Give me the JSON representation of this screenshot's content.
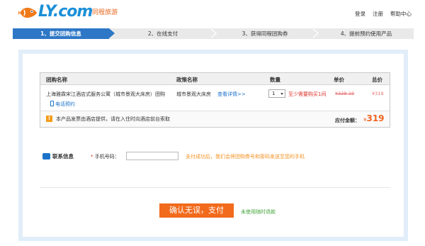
{
  "brand": {
    "logo_text": "LY.com",
    "logo_sub": "同程旅游"
  },
  "top_links": [
    "登录",
    "注册",
    "帮助中心"
  ],
  "steps": [
    "1、提交团购信息",
    "2、在线支付",
    "3、获得同程团购券",
    "4、提前预约使用产品"
  ],
  "table": {
    "headers": {
      "name": "团购名称",
      "policy": "政策名称",
      "qty": "数量",
      "unit": "单价",
      "total": "总价"
    },
    "row": {
      "hotel": "上海雅霖宋江酒店式服务公寓（城市景观大床房）团购",
      "phone_link": "电话预约",
      "policy": "城市景观大床房",
      "detail": "查看详情>>",
      "qty": "1",
      "min_buy": "至少需要购买1间",
      "orig_price": "¥338-19",
      "price": "¥319"
    },
    "footer": {
      "note": "本产品发票由酒店提供，请在入住时向酒店前台索取",
      "total_label": "应付金额：",
      "total_currency": "¥",
      "total_value": "319"
    }
  },
  "contact": {
    "title": "联系信息",
    "star": "*",
    "phone_label": "手机号码：",
    "phone_value": "",
    "hint": "支付成功后，我们会将团购券号和密码发送至您的手机"
  },
  "pay_button": "确认无误，支付",
  "pay_later": "未使用随时退款"
}
